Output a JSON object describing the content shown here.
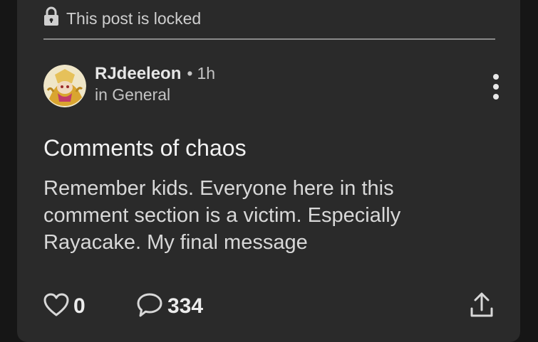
{
  "post": {
    "locked_text": "This post is locked",
    "author": "RJdeeleon",
    "separator": "•",
    "time": "1h",
    "community": "in General",
    "title": "Comments of chaos",
    "body": "Remember kids. Everyone here in this comment section is a victim. Especially Rayacake. My final message",
    "likes": "0",
    "comments": "334"
  },
  "icons": {
    "lock": "lock-icon",
    "more": "more-vertical-icon",
    "like": "heart-outline-icon",
    "comment": "speech-bubble-icon",
    "share": "share-upload-icon"
  },
  "colors": {
    "background": "#161616",
    "card": "#2a2a2a",
    "divider": "#8a8a8a",
    "text_primary": "#ededed",
    "text_secondary": "#c4c4c4"
  }
}
